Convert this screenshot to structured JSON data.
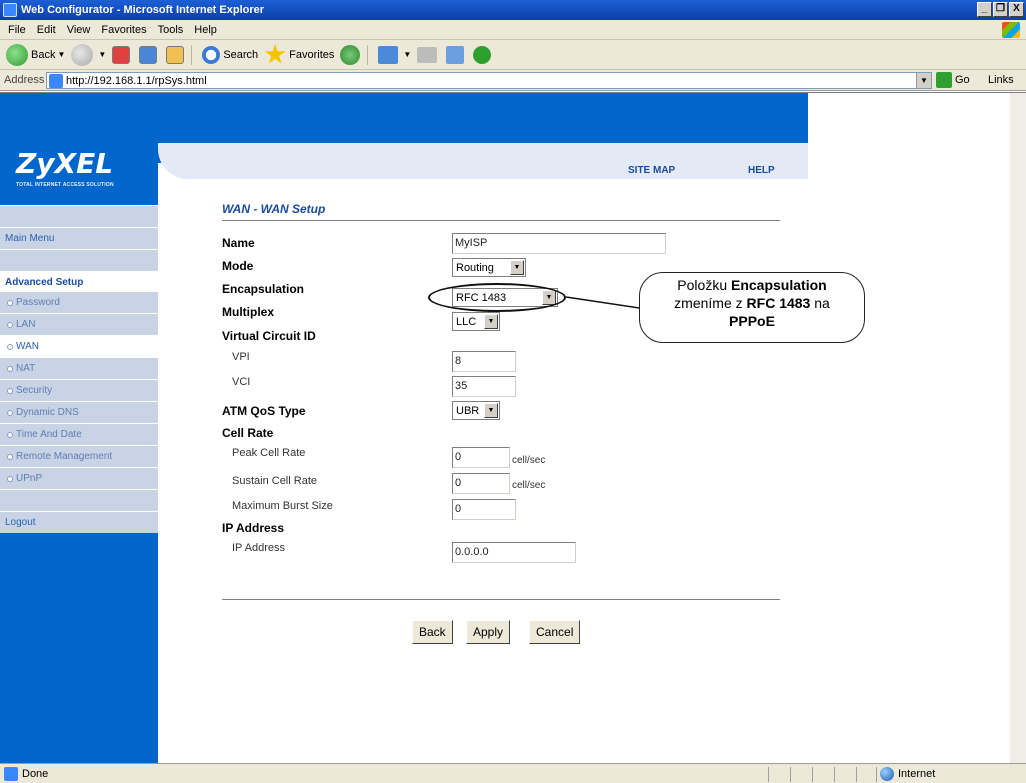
{
  "window": {
    "title": "Web Configurator - Microsoft Internet Explorer",
    "controls": [
      "_",
      "❐",
      "X"
    ]
  },
  "menu": [
    "File",
    "Edit",
    "View",
    "Favorites",
    "Tools",
    "Help"
  ],
  "toolbar": {
    "back": "Back",
    "search": "Search",
    "favorites": "Favorites"
  },
  "address": {
    "label": "Address",
    "url": "http://192.168.1.1/rpSys.html",
    "go": "Go",
    "links": "Links"
  },
  "brand": {
    "logo": "ZyXEL",
    "tagline": "TOTAL INTERNET ACCESS SOLUTION"
  },
  "top_links": {
    "site_map": "SITE MAP",
    "help": "HELP"
  },
  "sidebar": {
    "main_menu": "Main Menu",
    "advanced_setup": "Advanced Setup",
    "items": [
      {
        "label": "Password"
      },
      {
        "label": "LAN"
      },
      {
        "label": "WAN"
      },
      {
        "label": "NAT"
      },
      {
        "label": "Security"
      },
      {
        "label": "Dynamic DNS"
      },
      {
        "label": "Time And Date"
      },
      {
        "label": "Remote Management"
      },
      {
        "label": "UPnP"
      }
    ],
    "logout": "Logout"
  },
  "page": {
    "title": "WAN - WAN Setup",
    "fields": {
      "name": {
        "label": "Name",
        "value": "MyISP"
      },
      "mode": {
        "label": "Mode",
        "value": "Routing"
      },
      "encapsulation": {
        "label": "Encapsulation",
        "value": "RFC 1483"
      },
      "multiplex": {
        "label": "Multiplex",
        "value": "LLC"
      },
      "vci_header": "Virtual Circuit ID",
      "vpi": {
        "label": "VPI",
        "value": "8"
      },
      "vci": {
        "label": "VCI",
        "value": "35"
      },
      "qos": {
        "label": "ATM QoS Type",
        "value": "UBR"
      },
      "cell_rate": "Cell Rate",
      "peak": {
        "label": "Peak Cell Rate",
        "value": "0",
        "unit": "cell/sec"
      },
      "sustain": {
        "label": "Sustain Cell Rate",
        "value": "0",
        "unit": "cell/sec"
      },
      "burst": {
        "label": "Maximum Burst Size",
        "value": "0"
      },
      "ip_header": "IP Address",
      "ip": {
        "label": "IP Address",
        "value": "0.0.0.0"
      }
    },
    "buttons": {
      "back": "Back",
      "apply": "Apply",
      "cancel": "Cancel"
    }
  },
  "callout": {
    "line1_pre": "Položku ",
    "line1_bold": "Encapsulation",
    "line2_pre": "zmeníme z ",
    "line2_bold": "RFC 1483",
    "line2_post": " na",
    "line3_bold": "PPPoE"
  },
  "status": {
    "text": "Done",
    "zone": "Internet"
  }
}
